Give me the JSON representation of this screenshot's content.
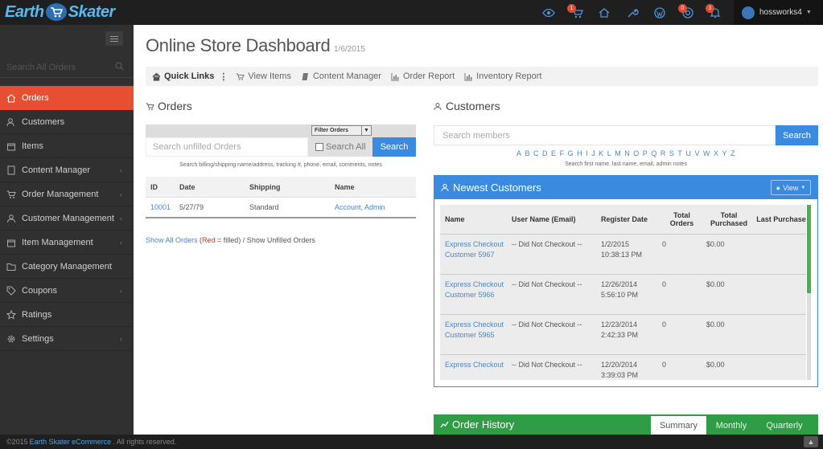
{
  "topbar": {
    "logo_left": "Earth",
    "logo_right": "Skater",
    "icons": [
      {
        "name": "eye-icon",
        "badge": ""
      },
      {
        "name": "cart-icon",
        "badge": "1"
      },
      {
        "name": "home-icon",
        "badge": ""
      },
      {
        "name": "wrench-icon",
        "badge": ""
      },
      {
        "name": "wordpress-icon",
        "badge": ""
      },
      {
        "name": "support-icon",
        "badge": "0"
      },
      {
        "name": "bell-icon",
        "badge": "3"
      }
    ],
    "username": "hossworks4"
  },
  "sidebar": {
    "search_placeholder": "Search All Orders",
    "items": [
      {
        "label": "Orders",
        "icon": "home-icon",
        "active": true,
        "chevron": false
      },
      {
        "label": "Customers",
        "icon": "users-icon",
        "active": false,
        "chevron": false
      },
      {
        "label": "Items",
        "icon": "box-icon",
        "active": false,
        "chevron": false
      },
      {
        "label": "Content Manager",
        "icon": "document-icon",
        "active": false,
        "chevron": true
      },
      {
        "label": "Order Management",
        "icon": "cart-icon",
        "active": false,
        "chevron": true
      },
      {
        "label": "Customer Management",
        "icon": "user-icon",
        "active": false,
        "chevron": true
      },
      {
        "label": "Item Management",
        "icon": "box-icon",
        "active": false,
        "chevron": true
      },
      {
        "label": "Category Management",
        "icon": "folder-icon",
        "active": false,
        "chevron": false
      },
      {
        "label": "Coupons",
        "icon": "tag-icon",
        "active": false,
        "chevron": true
      },
      {
        "label": "Ratings",
        "icon": "star-icon",
        "active": false,
        "chevron": false
      },
      {
        "label": "Settings",
        "icon": "gear-icon",
        "active": false,
        "chevron": true
      }
    ]
  },
  "header": {
    "title": "Online Store Dashboard",
    "date": "1/6/2015"
  },
  "quicklinks": {
    "title": "Quick Links",
    "links": [
      {
        "label": "View Items",
        "icon": "cart-icon"
      },
      {
        "label": "Content Manager",
        "icon": "book-icon"
      },
      {
        "label": "Order Report",
        "icon": "bar-chart-icon"
      },
      {
        "label": "Inventory Report",
        "icon": "bar-chart-icon"
      }
    ]
  },
  "orders": {
    "title": "Orders",
    "filter_label": "Filter Orders",
    "search_placeholder": "Search unfilled Orders",
    "search_all_label": "Search All",
    "search_button": "Search",
    "hint": "Search billing/shipping name/address, tracking #, phone, email, comments, notes",
    "columns": [
      "ID",
      "Date",
      "Shipping",
      "Name"
    ],
    "rows": [
      {
        "id": "10001",
        "date": "5/27/79",
        "shipping": "Standard",
        "name": "Account, Admin"
      }
    ],
    "legend_show_all": "Show All Orders",
    "legend_open": " (",
    "legend_red": "Red",
    "legend_rest": " = filled) / Show Unfilled Orders"
  },
  "customers": {
    "title": "Customers",
    "search_placeholder": "Search members",
    "search_button": "Search",
    "alphabet": [
      "A",
      "B",
      "C",
      "D",
      "E",
      "F",
      "G",
      "H",
      "I",
      "J",
      "K",
      "L",
      "M",
      "N",
      "O",
      "P",
      "Q",
      "R",
      "S",
      "T",
      "U",
      "V",
      "W",
      "X",
      "Y",
      "Z"
    ],
    "hint": "Search first name, last name, email, admin notes"
  },
  "newest_customers": {
    "title": "Newest Customers",
    "view_button": "View",
    "columns": [
      "Name",
      "User Name (Email)",
      "Register Date",
      "Total Orders",
      "Total Purchased",
      "Last Purchase"
    ],
    "rows": [
      {
        "name": "Express Checkout Customer 5967",
        "username": "-- Did Not Checkout --",
        "date": "1/2/2015",
        "time": "10:38:13 PM",
        "orders": "0",
        "purchased": "$0.00",
        "last": ""
      },
      {
        "name": "Express Checkout Customer 5966",
        "username": "-- Did Not Checkout --",
        "date": "12/26/2014",
        "time": "5:56:10 PM",
        "orders": "0",
        "purchased": "$0.00",
        "last": ""
      },
      {
        "name": "Express Checkout Customer 5965",
        "username": "-- Did Not Checkout --",
        "date": "12/23/2014",
        "time": "2:42:33 PM",
        "orders": "0",
        "purchased": "$0.00",
        "last": ""
      },
      {
        "name": "Express Checkout",
        "username": "-- Did Not Checkout --",
        "date": "12/20/2014",
        "time": "3:39:03 PM",
        "orders": "0",
        "purchased": "$0.00",
        "last": ""
      }
    ]
  },
  "order_history": {
    "title": "Order History",
    "tabs": [
      {
        "label": "Summary",
        "active": true
      },
      {
        "label": "Monthly",
        "active": false
      },
      {
        "label": "Quarterly",
        "active": false
      }
    ]
  },
  "footer": {
    "prefix": "©2015 ",
    "brand": "Earth Skater eCommerce",
    "suffix": ". All rights reserved."
  },
  "colors": {
    "accent": "#e74e32",
    "primary": "#3a8be0",
    "success": "#2e9d45",
    "sidebar": "#303030",
    "topbar": "#1f1f1f"
  }
}
